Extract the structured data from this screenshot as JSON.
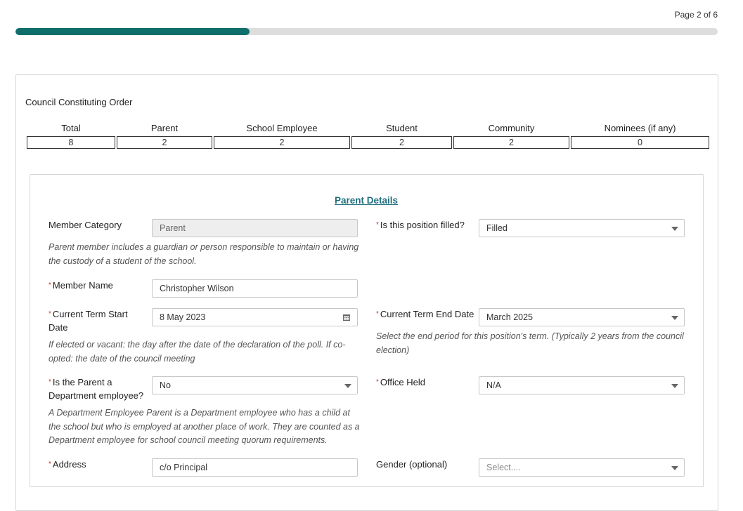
{
  "progress": {
    "page_label": "Page 2 of 6",
    "fraction": 0.333
  },
  "council": {
    "title": "Council Constituting Order",
    "columns": [
      "Total",
      "Parent",
      "School Employee",
      "Student",
      "Community",
      "Nominees (if any)"
    ],
    "values": [
      "8",
      "2",
      "2",
      "2",
      "2",
      "0"
    ]
  },
  "parent_details": {
    "heading": "Parent Details",
    "member_category": {
      "label": "Member Category",
      "value": "Parent",
      "hint": "Parent member includes a guardian or person responsible to maintain or having the custody of a student of the school."
    },
    "position_filled": {
      "label": "Is this position filled?",
      "value": "Filled"
    },
    "member_name": {
      "label": "Member Name",
      "value": "Christopher Wilson"
    },
    "term_start": {
      "label": "Current Term Start Date",
      "value": "8 May 2023",
      "hint": "If elected or vacant: the day after the date of the declaration of the poll. If co-opted: the date of the council meeting"
    },
    "term_end": {
      "label": "Current Term End Date",
      "value": "March 2025",
      "hint": "Select the end period for this position's term. (Typically 2 years from the council election)"
    },
    "dept_employee": {
      "label": "Is the Parent a Department employee?",
      "value": "No",
      "hint": "A Department Employee Parent is a Department employee who has a child at the school but who is employed at another place of work. They are counted as a Department employee for school council meeting quorum requirements."
    },
    "office_held": {
      "label": "Office Held",
      "value": "N/A"
    },
    "address": {
      "label": "Address",
      "value": "c/o Principal"
    },
    "gender": {
      "label": "Gender (optional)",
      "placeholder": "Select...."
    }
  },
  "colors": {
    "accent": "#0e6f6b",
    "heading": "#1f6e7e",
    "required": "#c0392b"
  },
  "icons": {
    "dropdown": "chevron-down-icon",
    "date": "calendar-icon"
  }
}
